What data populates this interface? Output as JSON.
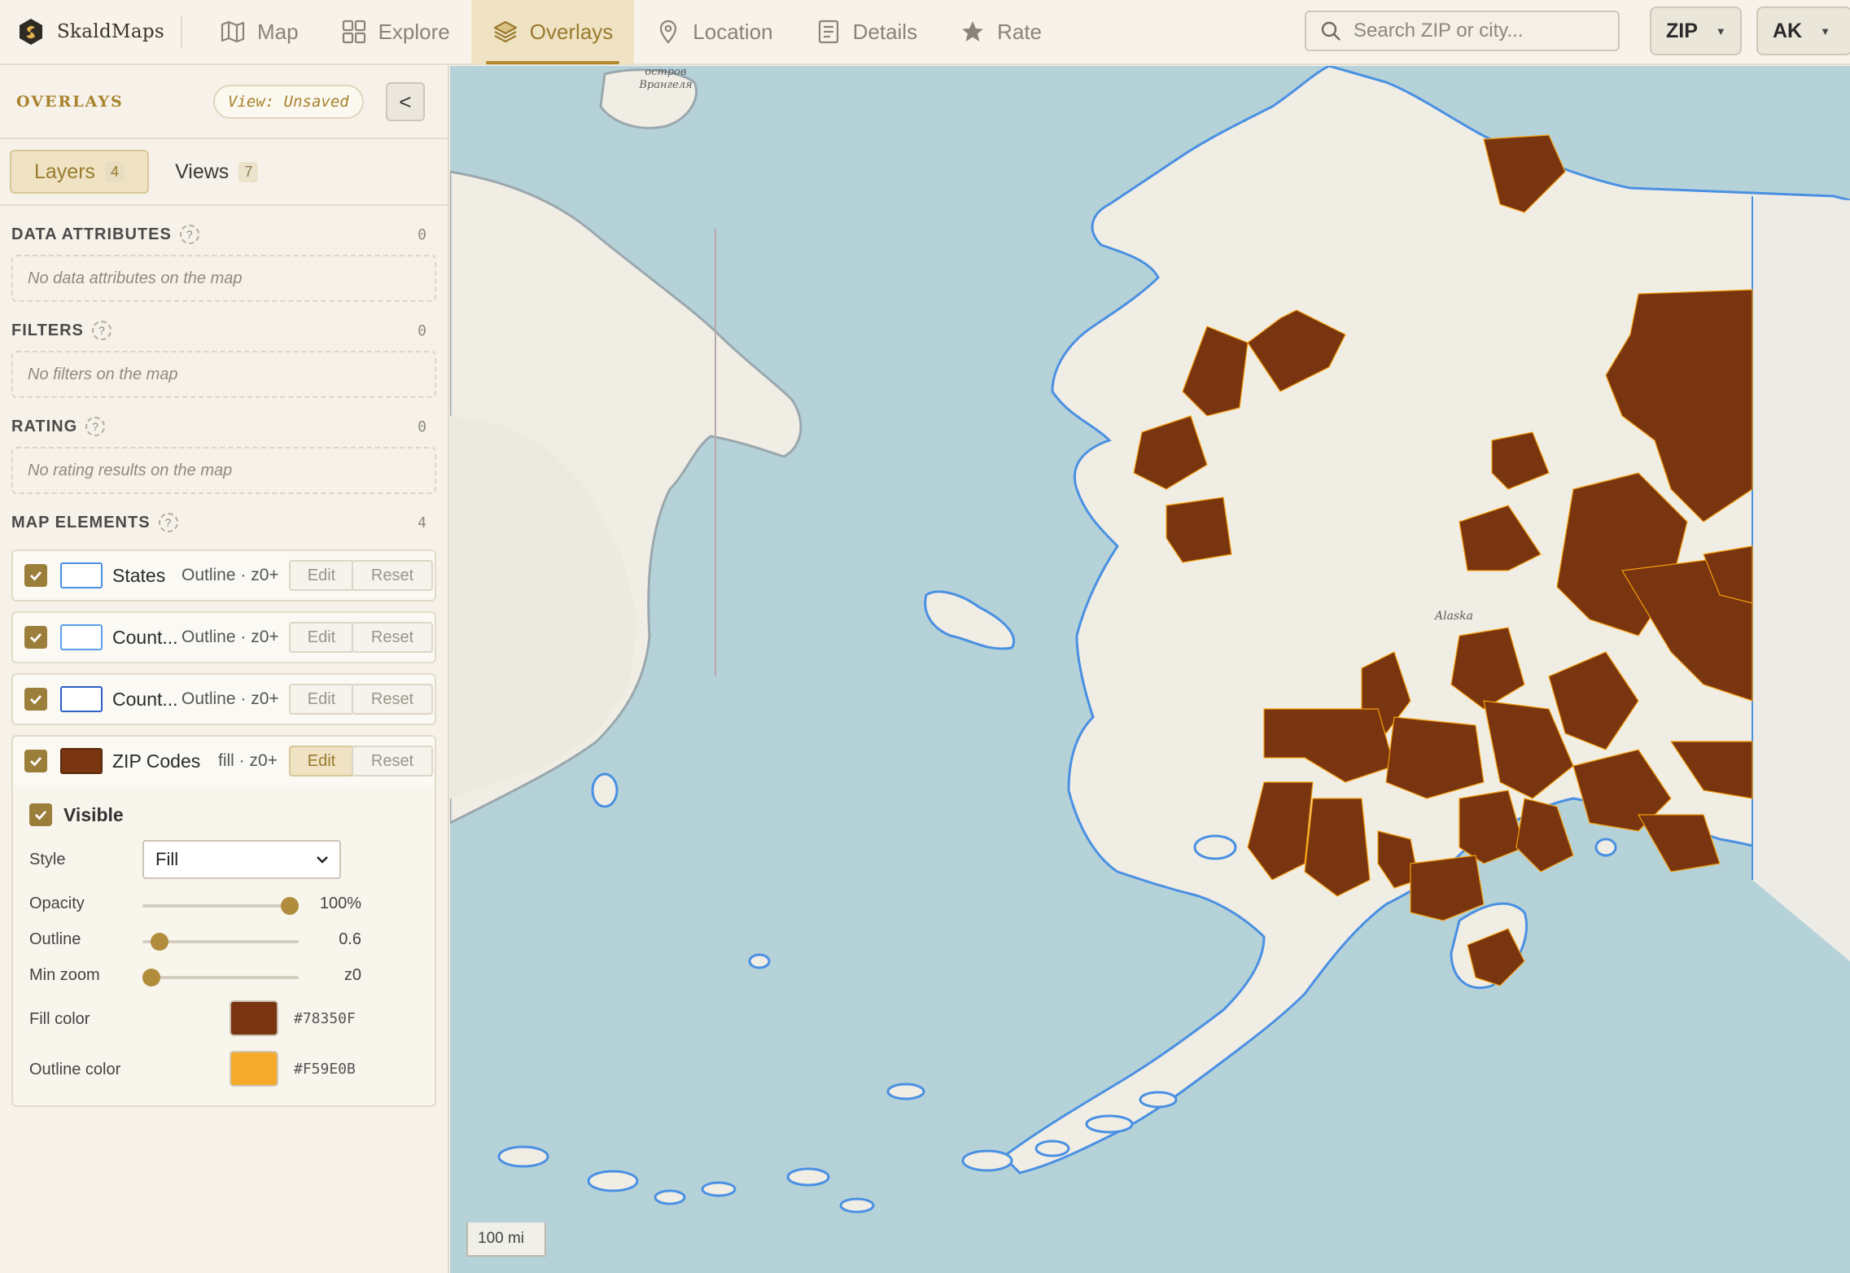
{
  "app": {
    "name": "SkaldMaps"
  },
  "nav": {
    "tabs": [
      {
        "label": "Map",
        "icon": "map-icon"
      },
      {
        "label": "Explore",
        "icon": "grid-icon"
      },
      {
        "label": "Overlays",
        "icon": "layers-icon",
        "active": true
      },
      {
        "label": "Location",
        "icon": "pin-icon"
      },
      {
        "label": "Details",
        "icon": "document-icon"
      },
      {
        "label": "Rate",
        "icon": "star-icon"
      }
    ],
    "search_placeholder": "Search ZIP or city...",
    "zip_selector": "ZIP",
    "state_selector": "AK"
  },
  "sidebar": {
    "title": "OVERLAYS",
    "view_badge": "View: Unsaved",
    "collapse_label": "<",
    "tabs": [
      {
        "label": "Layers",
        "count": "4",
        "active": true
      },
      {
        "label": "Views",
        "count": "7"
      }
    ],
    "sections": {
      "data_attributes": {
        "label": "DATA ATTRIBUTES",
        "count": "0",
        "empty": "No data attributes on the map"
      },
      "filters": {
        "label": "FILTERS",
        "count": "0",
        "empty": "No filters on the map"
      },
      "rating": {
        "label": "RATING",
        "count": "0",
        "empty": "No rating results on the map"
      },
      "map_elements": {
        "label": "MAP ELEMENTS",
        "count": "4"
      }
    },
    "elements": [
      {
        "name": "States",
        "meta": "Outline · z0+",
        "swatch_border": "#4a90e2",
        "swatch_fill": "#ffffff",
        "checked": true
      },
      {
        "name": "Count...",
        "meta": "Outline · z0+",
        "swatch_border": "#5aa0e8",
        "swatch_fill": "#ffffff",
        "checked": true
      },
      {
        "name": "Count...",
        "meta": "Outline · z0+",
        "swatch_border": "#2d5fc4",
        "swatch_fill": "#ffffff",
        "checked": true
      },
      {
        "name": "ZIP Codes",
        "meta": "fill · z0+",
        "swatch_border": "#5a2a0a",
        "swatch_fill": "#78350F",
        "checked": true,
        "editing": true
      }
    ],
    "element_buttons": {
      "edit": "Edit",
      "reset": "Reset"
    },
    "editor": {
      "visible_label": "Visible",
      "style_label": "Style",
      "style_value": "Fill",
      "opacity_label": "Opacity",
      "opacity_value": "100%",
      "opacity_level": 1.0,
      "outline_label": "Outline",
      "outline_value": "0.6",
      "outline_level": 0.06,
      "minzoom_label": "Min zoom",
      "minzoom_value": "z0",
      "minzoom_level": 0.0,
      "fill_label": "Fill color",
      "fill_hex": "#78350F",
      "outline_color_label": "Outline color",
      "outline_hex": "#F59E0B"
    }
  },
  "map": {
    "scale_label": "100 mi",
    "place_labels": [
      "остров Врангеля",
      "Alaska"
    ],
    "colors": {
      "water": "#b6d2d9",
      "land": "#f0ede5",
      "zip_fill": "#78350F",
      "zip_outline": "#F59E0B",
      "state_outline": "#4a90e2"
    }
  }
}
